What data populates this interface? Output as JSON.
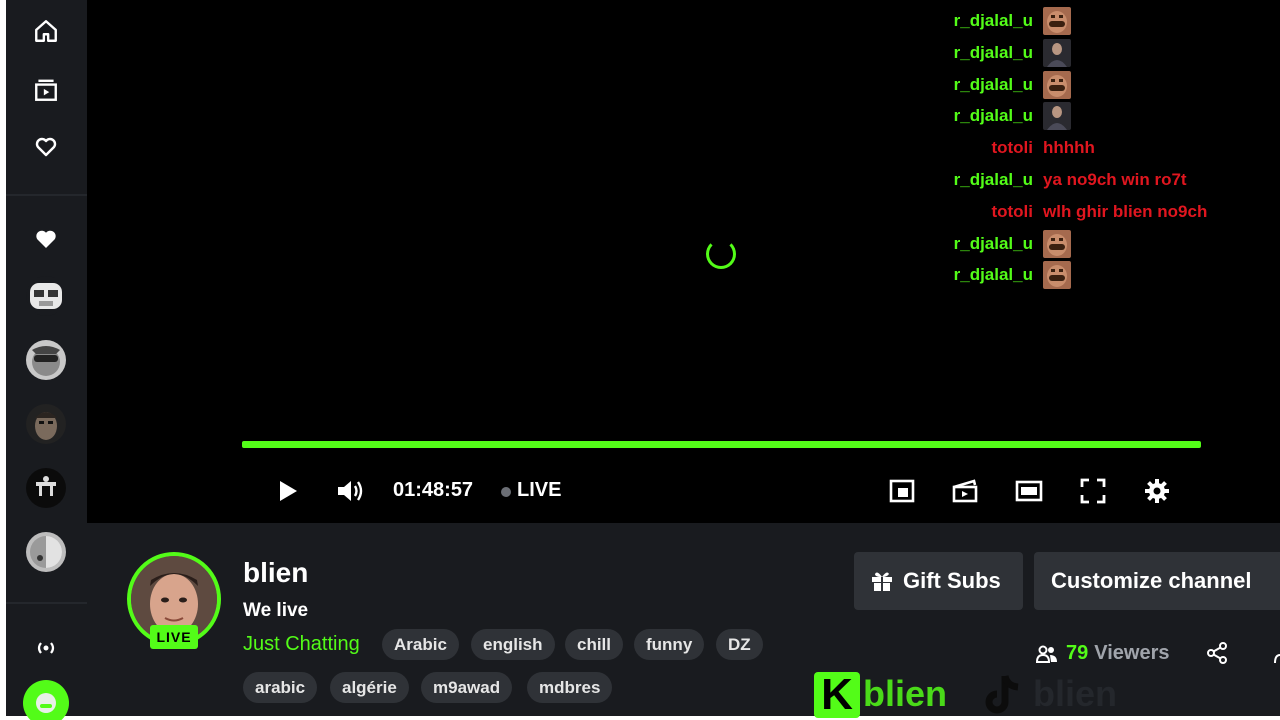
{
  "sidebar": {
    "nav": [
      "home-icon",
      "following-icon",
      "heart-outline-icon"
    ],
    "followed_channels": [
      "channel-avatar-1",
      "channel-avatar-2",
      "channel-avatar-3",
      "channel-avatar-4",
      "channel-avatar-5",
      "channel-avatar-6"
    ]
  },
  "chat": {
    "messages": [
      {
        "user": "r_djalal_u",
        "name_color": "#53fc18",
        "text": "",
        "emote": "face-emote"
      },
      {
        "user": "r_djalal_u",
        "name_color": "#53fc18",
        "text": "",
        "emote": "man-emote"
      },
      {
        "user": "r_djalal_u",
        "name_color": "#53fc18",
        "text": "",
        "emote": "face-emote"
      },
      {
        "user": "r_djalal_u",
        "name_color": "#53fc18",
        "text": "",
        "emote": "man-emote"
      },
      {
        "user": "totoli",
        "name_color": "#e0161f",
        "text": "hhhhh",
        "emote": ""
      },
      {
        "user": "r_djalal_u",
        "name_color": "#53fc18",
        "text": "ya no9ch win ro7t",
        "emote": ""
      },
      {
        "user": "totoli",
        "name_color": "#e0161f",
        "text": "wlh ghir blien no9ch",
        "emote": ""
      },
      {
        "user": "r_djalal_u",
        "name_color": "#53fc18",
        "text": "",
        "emote": "face-emote"
      },
      {
        "user": "r_djalal_u",
        "name_color": "#53fc18",
        "text": "",
        "emote": "face-emote"
      }
    ],
    "message_text_color": "#e0161f"
  },
  "player": {
    "time": "01:48:57",
    "live_label": "LIVE",
    "progress": 1.0,
    "accent": "#53fc18"
  },
  "channel": {
    "name": "blien",
    "title": "We live",
    "category": "Just Chatting",
    "live_badge": "LIVE",
    "tags": [
      "Arabic",
      "english",
      "chill",
      "funny",
      "DZ",
      "arabic",
      "algérie",
      "m9awad",
      "mdbres"
    ],
    "gift_subs_label": "Gift Subs",
    "customize_label": "Customize channel",
    "viewers_count": "79",
    "viewers_label": "Viewers"
  },
  "watermark": {
    "kick_text": "blien",
    "tiktok_text": "blien"
  }
}
